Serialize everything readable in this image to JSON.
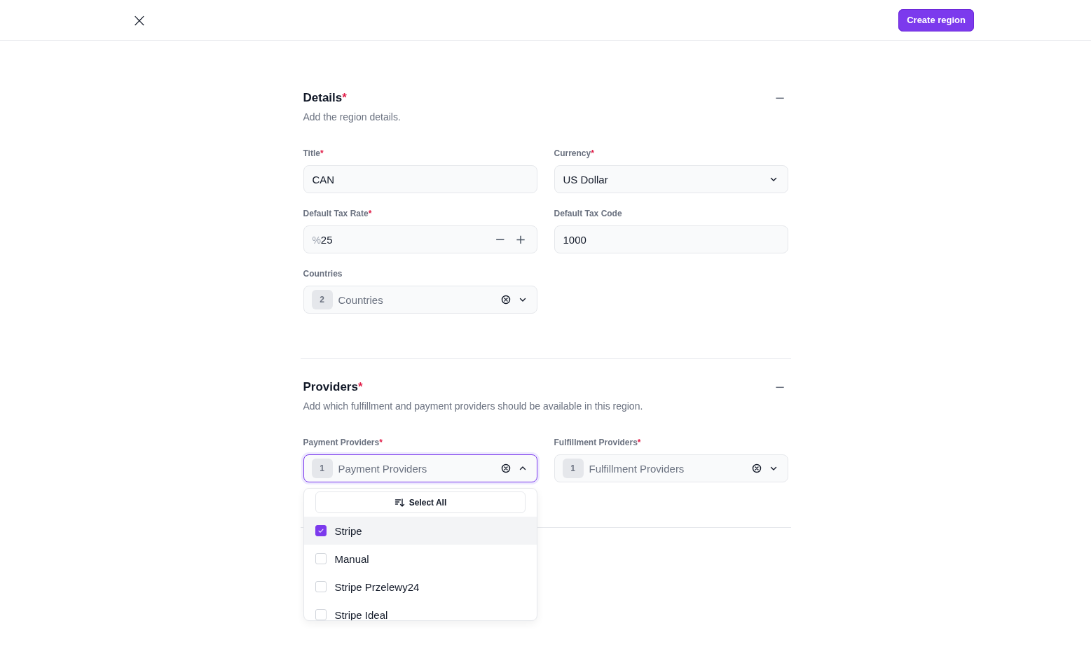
{
  "header": {
    "close_label": "×",
    "primary_button": "Create region"
  },
  "sections": [
    {
      "title": "Details",
      "required_mark": "*",
      "collapse_symbol": "−",
      "description": "Add the region details.",
      "fields": [
        {
          "kind": "text",
          "label": "Title",
          "required_mark": "*",
          "value": "CAN"
        },
        {
          "kind": "select",
          "label": "Currency",
          "required_mark": "*",
          "value": "US Dollar",
          "expanded": false
        },
        {
          "kind": "number",
          "label": "Default Tax Rate",
          "required_mark": "*",
          "prefix": "%",
          "value": "25",
          "minus": "−",
          "plus": "+"
        },
        {
          "kind": "text",
          "label": "Default Tax Code",
          "value": "1000"
        },
        {
          "kind": "multiselect",
          "label": "Countries",
          "count": "2",
          "placeholder": "Countries",
          "expanded": false
        }
      ]
    },
    {
      "title": "Providers",
      "required_mark": "*",
      "collapse_symbol": "−",
      "description": "Add which fulfillment and payment providers should be available in this region.",
      "fields": [
        {
          "kind": "multiselect",
          "label": "Payment Providers",
          "required_mark": "*",
          "count": "1",
          "placeholder": "Payment Providers",
          "expanded": true,
          "menu": {
            "select_all": "Select All",
            "options": [
              {
                "label": "Stripe",
                "checked": true,
                "highlighted": true
              },
              {
                "label": "Manual",
                "checked": false,
                "highlighted": false
              },
              {
                "label": "Stripe Przelewy24",
                "checked": false,
                "highlighted": false
              },
              {
                "label": "Stripe Ideal",
                "checked": false,
                "highlighted": false
              }
            ]
          }
        },
        {
          "kind": "multiselect",
          "label": "Fulfillment Providers",
          "required_mark": "*",
          "count": "1",
          "placeholder": "Fulfillment Providers",
          "expanded": false
        }
      ]
    }
  ]
}
